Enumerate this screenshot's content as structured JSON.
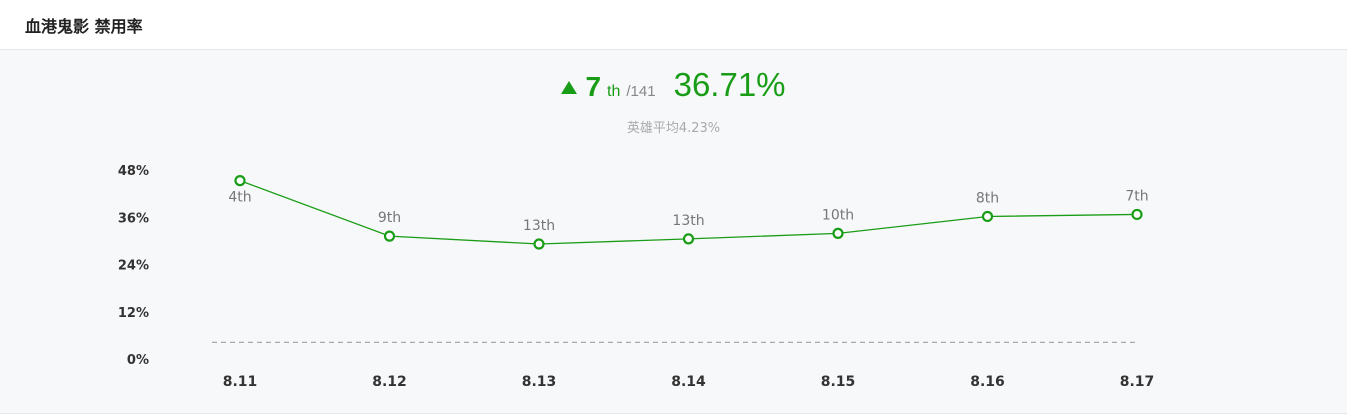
{
  "header": {
    "title": "血港鬼影 禁用率"
  },
  "summary": {
    "rank": "7",
    "rank_suffix": "th",
    "rank_total": "/141",
    "rate": "36.71%",
    "average_text": "英雄平均4.23%",
    "trend_icon": "up-triangle-icon",
    "accent_color": "#1a9d16"
  },
  "chart_data": {
    "type": "line",
    "categories": [
      "8.11",
      "8.12",
      "8.13",
      "8.14",
      "8.15",
      "8.16",
      "8.17"
    ],
    "series": [
      {
        "values": [
          45.3,
          31.2,
          29.2,
          30.5,
          31.9,
          36.2,
          36.71
        ],
        "labels": [
          "4th",
          "9th",
          "13th",
          "13th",
          "10th",
          "8th",
          "7th"
        ],
        "color": "#1a9d16"
      }
    ],
    "reference_line": 4.23,
    "yticks": [
      "48%",
      "36%",
      "24%",
      "12%",
      "0%"
    ],
    "ylim": [
      0,
      48
    ],
    "grid": false,
    "legend": "none"
  }
}
